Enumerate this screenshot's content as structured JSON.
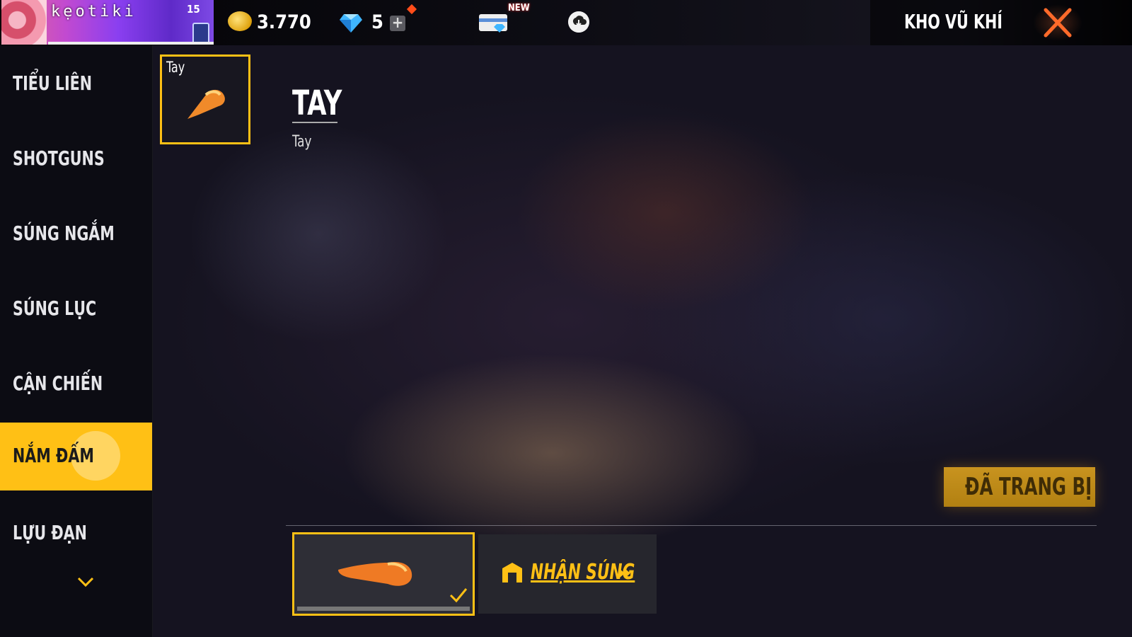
{
  "topbar": {
    "player_name": "kẹotiki",
    "level": "15",
    "coins": "3.770",
    "diamonds": "5",
    "new_badge": "NEW",
    "title": "KHO VŨ KHÍ"
  },
  "sidebar": {
    "items": [
      {
        "label": "TIỂU LIÊN",
        "active": false
      },
      {
        "label": "SHOTGUNS",
        "active": false
      },
      {
        "label": "SÚNG NGẮM",
        "active": false
      },
      {
        "label": "SÚNG LỤC",
        "active": false
      },
      {
        "label": "CẬN CHIẾN",
        "active": false
      },
      {
        "label": "NẮM ĐẤM",
        "active": true
      },
      {
        "label": "LỰU ĐẠN",
        "active": false
      }
    ]
  },
  "weapon": {
    "card_label": "Tay",
    "name": "TAY",
    "subtitle": "Tay"
  },
  "actions": {
    "equipped_label": "ĐÃ TRANG BỊ",
    "get_weapon_label": "NHẬN SÚNG"
  },
  "colors": {
    "accent": "#ffc015",
    "close": "#ff6a2a"
  },
  "icons": [
    "coin-icon",
    "diamond-icon",
    "plus-icon",
    "card-icon",
    "cloud-download-icon",
    "close-icon",
    "fist-icon",
    "checkmark-icon",
    "chevron-down-icon",
    "store-icon",
    "arrow-right-icon",
    "rank-badge-icon"
  ]
}
